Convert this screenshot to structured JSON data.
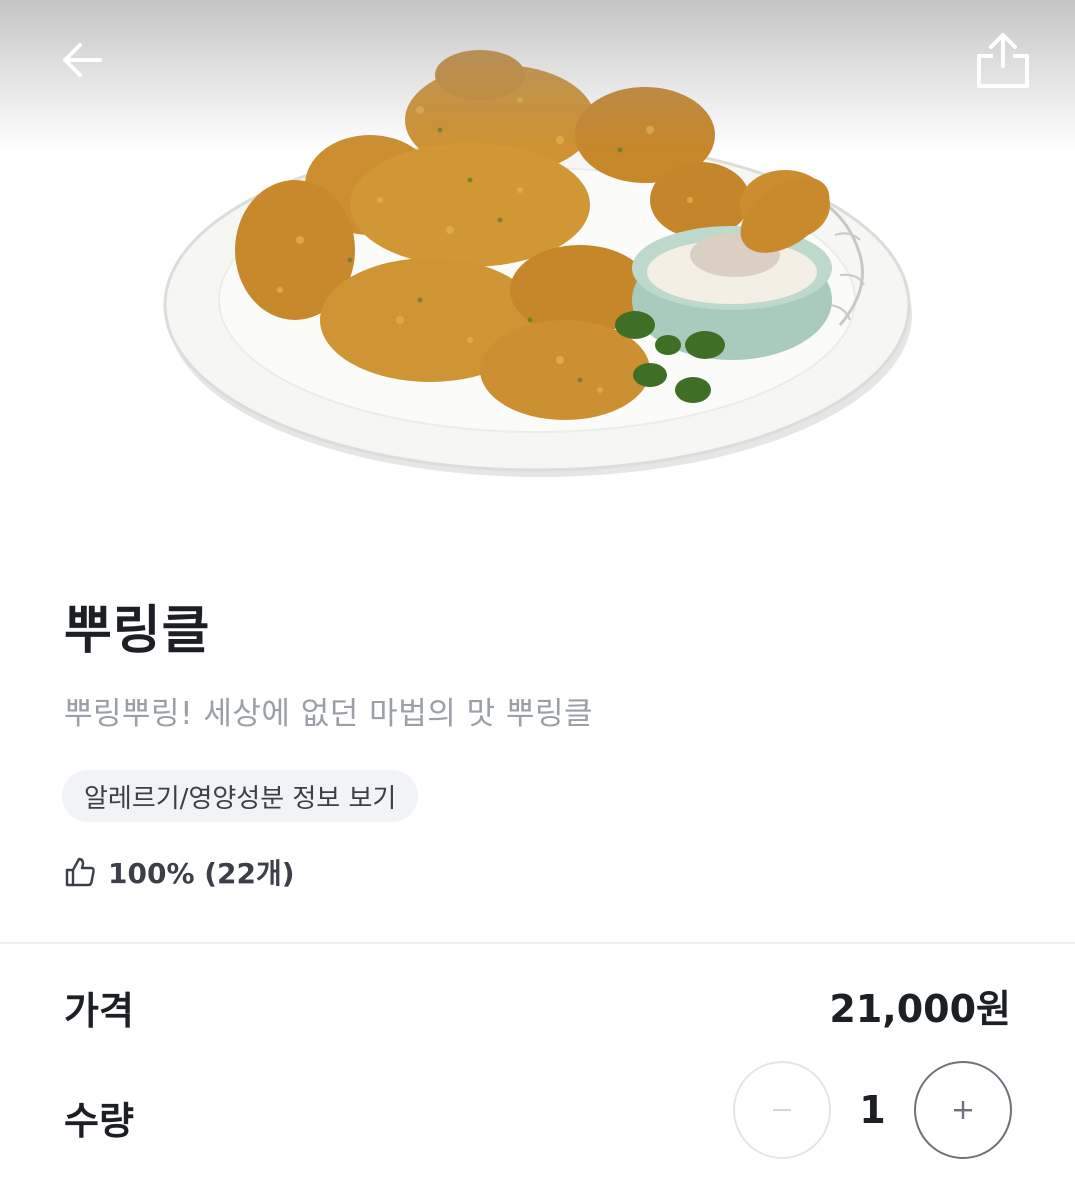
{
  "header": {
    "back_icon": "arrow-left-icon",
    "share_icon": "share-icon"
  },
  "product": {
    "image_icon": "fried-chicken-photo",
    "name": "뿌링클",
    "description": "뿌링뿌링! 세상에 없던 마법의 맛 뿌링클",
    "info_chip_label": "알레르기/영양성분 정보 보기",
    "rating_icon": "thumbs-up-icon",
    "rating_text": "100% (22개)"
  },
  "order": {
    "price_label": "가격",
    "price_value": "21,000원",
    "quantity_label": "수량",
    "quantity_value": "1",
    "minus_symbol": "−",
    "plus_symbol": "+"
  },
  "colors": {
    "text_primary": "#1c1f24",
    "text_secondary": "#9aa0a8",
    "chip_background": "#f1f3f6",
    "divider": "#eceef1"
  }
}
